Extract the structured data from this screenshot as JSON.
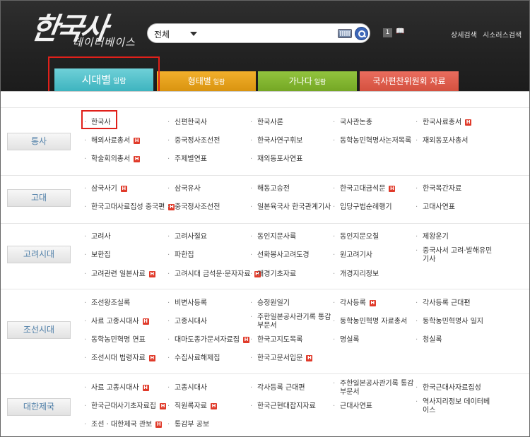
{
  "header": {
    "logo_main": "한국사",
    "logo_sub": "데이터베이스",
    "search_select": "전체",
    "count_value": "1",
    "count_unit": "📖",
    "top_links": [
      "상세검색",
      "시소러스검색"
    ]
  },
  "tabs": [
    {
      "label": "시대별",
      "suffix": "일람"
    },
    {
      "label": "형태별",
      "suffix": "일람"
    },
    {
      "label": "가나다",
      "suffix": "일람"
    },
    {
      "label": "국사편찬위원회 자료",
      "suffix": ""
    }
  ],
  "badge_label": "H",
  "categories": [
    {
      "name": "통사",
      "items": [
        {
          "label": "한국사",
          "h": false
        },
        {
          "label": "신편한국사",
          "h": false
        },
        {
          "label": "한국사론",
          "h": false
        },
        {
          "label": "국사관논총",
          "h": false
        },
        {
          "label": "한국사료총서",
          "h": true
        },
        {
          "label": "해외사료총서",
          "h": true
        },
        {
          "label": "중국정사조선전",
          "h": false
        },
        {
          "label": "한국사연구휘보",
          "h": false
        },
        {
          "label": "동학농민혁명사논저목록",
          "h": false
        },
        {
          "label": "재외동포사총서",
          "h": false
        },
        {
          "label": "학술회의총서",
          "h": true
        },
        {
          "label": "주제별연표",
          "h": false
        },
        {
          "label": "재외동포사연표",
          "h": false
        }
      ]
    },
    {
      "name": "고대",
      "items": [
        {
          "label": "삼국사기",
          "h": true
        },
        {
          "label": "삼국유사",
          "h": false
        },
        {
          "label": "해동고승전",
          "h": false
        },
        {
          "label": "한국고대금석문",
          "h": true
        },
        {
          "label": "한국목간자료",
          "h": false
        },
        {
          "label": "한국고대사료집성 중국편",
          "h": true
        },
        {
          "label": "중국정사조선전",
          "h": false
        },
        {
          "label": "일본육국사 한국관계기사",
          "h": false
        },
        {
          "label": "입당구법순례행기",
          "h": false
        },
        {
          "label": "고대사연표",
          "h": false
        }
      ]
    },
    {
      "name": "고려시대",
      "items": [
        {
          "label": "고려사",
          "h": false
        },
        {
          "label": "고려사절요",
          "h": false
        },
        {
          "label": "동인지문사륙",
          "h": false
        },
        {
          "label": "동인지문오칠",
          "h": false
        },
        {
          "label": "제왕운기",
          "h": false
        },
        {
          "label": "보한집",
          "h": false
        },
        {
          "label": "파한집",
          "h": false
        },
        {
          "label": "선화봉사고려도경",
          "h": false
        },
        {
          "label": "원고려기사",
          "h": false
        },
        {
          "label": "중국사서 고려·발해유민 기사",
          "h": false
        },
        {
          "label": "고려관련 일본사료",
          "h": true
        },
        {
          "label": "고려시대 금석문·문자자료",
          "h": true
        },
        {
          "label": "개경기초자료",
          "h": false
        },
        {
          "label": "개경지리정보",
          "h": false
        }
      ]
    },
    {
      "name": "조선시대",
      "items": [
        {
          "label": "조선왕조실록",
          "h": false
        },
        {
          "label": "비변사등록",
          "h": false
        },
        {
          "label": "승정원일기",
          "h": false
        },
        {
          "label": "각사등록",
          "h": true
        },
        {
          "label": "각사등록 근대편",
          "h": false
        },
        {
          "label": "사료 고종시대사",
          "h": true
        },
        {
          "label": "고종시대사",
          "h": false
        },
        {
          "label": "주한일본공사관기록 통감부문서",
          "h": false
        },
        {
          "label": "동학농민혁명 자료총서",
          "h": false
        },
        {
          "label": "동학농민혁명사 일지",
          "h": false
        },
        {
          "label": "동학농민혁명 연표",
          "h": false
        },
        {
          "label": "대마도종가문서자료집",
          "h": true
        },
        {
          "label": "한국고지도목록",
          "h": false
        },
        {
          "label": "명실록",
          "h": false
        },
        {
          "label": "청실록",
          "h": false
        },
        {
          "label": "조선시대 법령자료",
          "h": true
        },
        {
          "label": "수집사료해제집",
          "h": false
        },
        {
          "label": "한국고문서입문",
          "h": true
        }
      ]
    },
    {
      "name": "대한제국",
      "items": [
        {
          "label": "사료 고종시대사",
          "h": true
        },
        {
          "label": "고종시대사",
          "h": false
        },
        {
          "label": "각사등록 근대편",
          "h": false
        },
        {
          "label": "주한일본공사관기록 통감부문서",
          "h": false
        },
        {
          "label": "한국근대사자료집성",
          "h": false
        },
        {
          "label": "한국근대사기초자료집",
          "h": true
        },
        {
          "label": "직원록자료",
          "h": true
        },
        {
          "label": "한국근현대잡지자료",
          "h": false
        },
        {
          "label": "근대사연표",
          "h": false
        },
        {
          "label": "역사지리정보 데이터베이스",
          "h": false
        },
        {
          "label": "조선 · 대한제국 관보",
          "h": true
        },
        {
          "label": "통감부 공보",
          "h": false
        }
      ]
    }
  ]
}
